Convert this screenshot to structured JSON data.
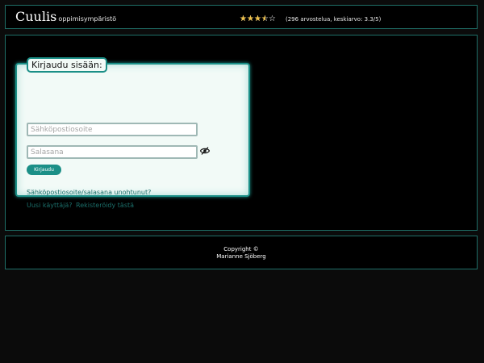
{
  "header": {
    "brand": "Cuulis",
    "tagline": "- oppimisympäristö",
    "rating": {
      "stars": 3.5,
      "max": 5,
      "text": "(296 arvostelua, keskiarvo: 3.3/5)"
    }
  },
  "login": {
    "title": "Kirjaudu sisään:",
    "email_placeholder": "Sähköpostiosoite",
    "password_placeholder": "Salasana",
    "button_label": "Kirjaudu",
    "forgot_link": "Sähköpostiosoite/salasana unohtunut?",
    "new_user_text": "Uusi käyttäjä?",
    "register_link": "Rekisteröidy tästä"
  },
  "footer": {
    "copyright_line1": "Copyright ©",
    "copyright_line2": "Marianne Sjöberg"
  },
  "colors": {
    "accent": "#1b8f87",
    "star": "#f0c24a"
  },
  "icons": {
    "password_toggle": "eye-icon",
    "rating": "star-icon"
  }
}
